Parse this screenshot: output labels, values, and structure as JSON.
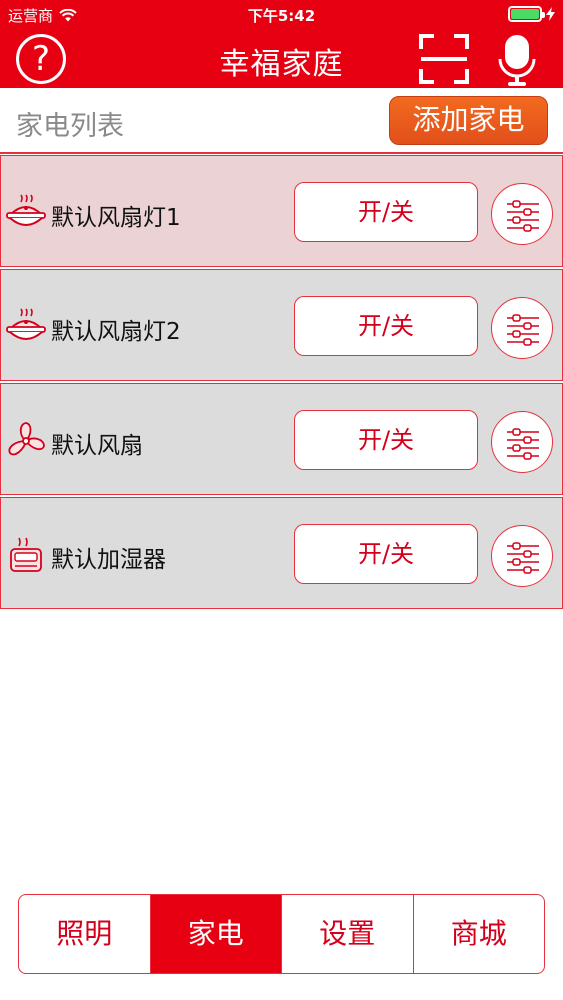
{
  "status_bar": {
    "carrier": "运营商",
    "time": "下午5:42",
    "battery_level": 1.0
  },
  "nav": {
    "title": "幸福家庭",
    "help_icon": "question-icon",
    "scan_icon": "scan-icon",
    "mic_icon": "microphone-icon"
  },
  "sub_header": {
    "title": "家电列表",
    "add_label": "添加家电"
  },
  "devices": [
    {
      "name": "默认风扇灯1",
      "icon": "fan-light-icon",
      "toggle_label": "开/关",
      "selected": true
    },
    {
      "name": "默认风扇灯2",
      "icon": "fan-light-icon",
      "toggle_label": "开/关",
      "selected": false
    },
    {
      "name": "默认风扇",
      "icon": "fan-icon",
      "toggle_label": "开/关",
      "selected": false
    },
    {
      "name": "默认加湿器",
      "icon": "humidifier-icon",
      "toggle_label": "开/关",
      "selected": false
    }
  ],
  "tabs": [
    {
      "label": "照明",
      "active": false
    },
    {
      "label": "家电",
      "active": true
    },
    {
      "label": "设置",
      "active": false
    },
    {
      "label": "商城",
      "active": false
    }
  ],
  "colors": {
    "brand_red": "#e60012",
    "add_button_orange": "#ec5d1d",
    "selected_row": "#ebd2d5",
    "row_gray": "#dcdcdc"
  }
}
